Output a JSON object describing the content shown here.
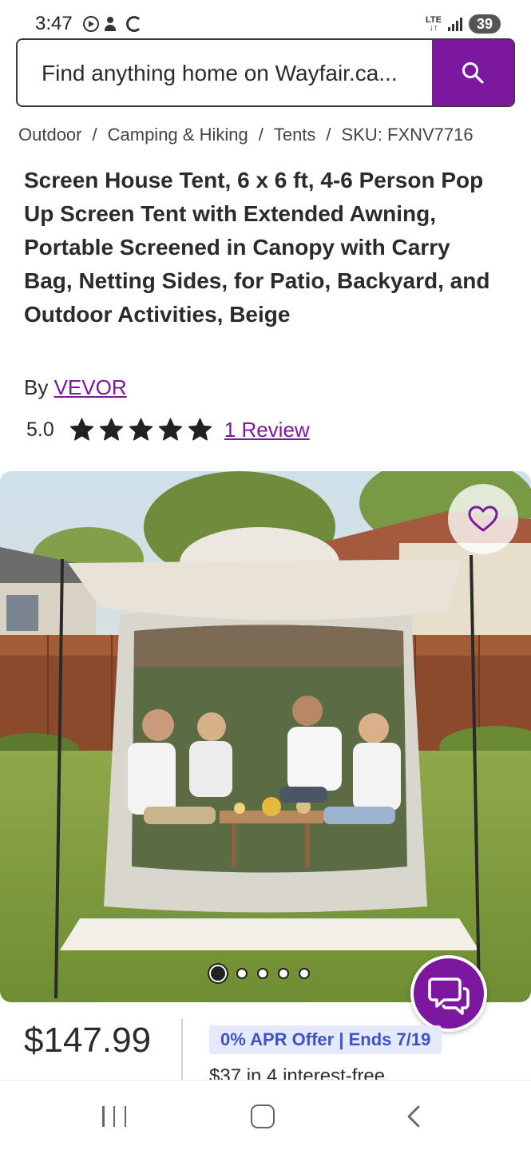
{
  "status_bar": {
    "time": "3:47",
    "network": "LTE",
    "battery": "39"
  },
  "search": {
    "placeholder": "Find anything home on Wayfair.ca..."
  },
  "breadcrumb": {
    "items": [
      "Outdoor",
      "Camping & Hiking",
      "Tents"
    ],
    "sku": "SKU: FXNV7716",
    "separator": "/"
  },
  "product": {
    "title": "Screen House Tent, 6 x 6 ft, 4-6 Person Pop Up Screen Tent with Extended Awning, Portable Screened in Canopy with Carry Bag, Netting Sides, for Patio, Backyard, and Outdoor Activities, Beige",
    "by_label": "By",
    "brand": "VEVOR",
    "rating": "5.0",
    "stars_filled": 5,
    "stars_total": 5,
    "review_link": "1 Review",
    "image_count": 5,
    "active_image_index": 0,
    "price": "$147.99",
    "apr_offer": "0% APR Offer | Ends 7/19",
    "installments": "$37 in 4 interest-free"
  },
  "colors": {
    "brand_purple": "#7b189f",
    "apr_text": "#3b54c8",
    "apr_bg": "#e6e9fb"
  },
  "icons": {
    "search": "search-icon",
    "favorite": "heart-outline-icon",
    "chat": "chat-bubbles-icon",
    "nav_recents": "recents-icon",
    "nav_home": "home-icon",
    "nav_back": "back-chevron-icon"
  }
}
